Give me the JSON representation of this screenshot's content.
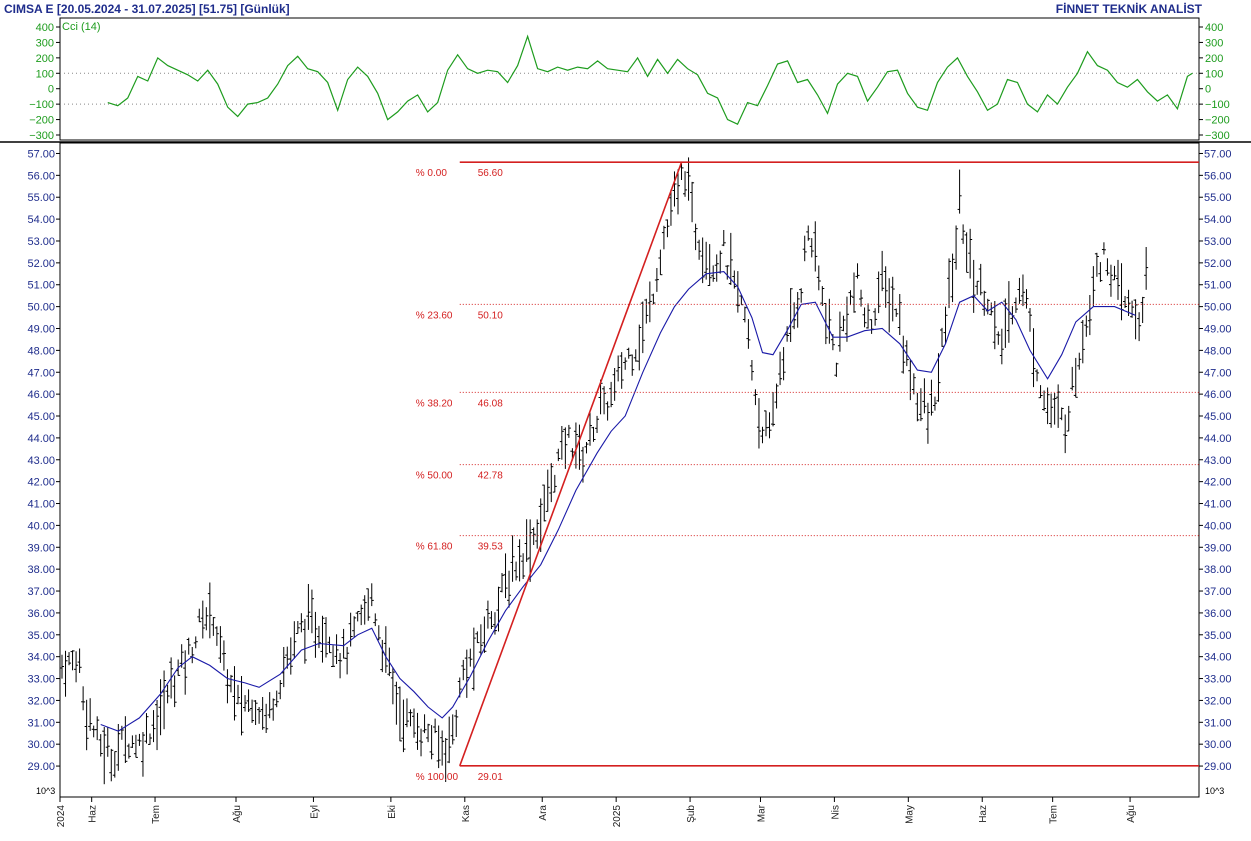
{
  "header": {
    "title": "CIMSA E  [20.05.2024 - 31.07.2025]  [51.75]  [Günlük]",
    "brand": "FİNNET TEKNİK ANALİST"
  },
  "colors": {
    "text": "#1f2d8c",
    "cci": "#1e9c1e",
    "fib": "#d42020",
    "ma": "#1a1aa8",
    "bars": "#000000"
  },
  "chart_data": [
    {
      "type": "line",
      "name": "cci-panel",
      "legend": "Cci (14)",
      "ylim": [
        -300,
        400
      ],
      "ticks": [
        400,
        300,
        200,
        100,
        0,
        -100,
        -200,
        -300
      ],
      "tick_labels": [
        "400",
        "300",
        "200",
        "100",
        "0",
        "−100",
        "−200",
        "−300"
      ],
      "reference_lines": [
        100,
        -100
      ],
      "x": [
        0,
        4,
        8,
        12,
        16,
        20,
        24,
        28,
        32,
        36,
        40,
        44,
        48,
        52,
        56,
        60,
        64,
        68,
        72,
        76,
        80,
        84,
        88,
        92,
        96,
        100,
        104,
        108,
        112,
        116,
        120,
        124,
        128,
        132,
        136,
        140,
        144,
        148,
        152,
        156,
        160,
        164,
        168,
        172,
        176,
        180,
        184,
        188,
        192,
        196,
        200,
        204,
        208,
        212,
        216,
        220,
        224,
        228,
        232,
        236,
        240,
        244,
        248,
        252,
        256,
        260,
        264,
        268,
        272,
        276,
        280,
        284,
        288,
        292,
        296,
        300,
        304,
        308,
        312,
        316,
        320,
        324,
        328,
        332,
        336,
        340,
        344,
        348,
        352,
        356,
        360,
        364,
        368,
        372,
        376,
        380,
        384,
        388,
        392,
        396,
        400,
        404,
        408,
        412,
        416,
        420,
        424,
        428,
        432,
        434
      ],
      "values": [
        -90,
        -110,
        -60,
        80,
        50,
        200,
        150,
        120,
        90,
        50,
        120,
        30,
        -120,
        -180,
        -100,
        -90,
        -60,
        30,
        150,
        210,
        130,
        110,
        40,
        -140,
        60,
        140,
        80,
        -30,
        -200,
        -150,
        -80,
        -40,
        -150,
        -90,
        120,
        220,
        130,
        100,
        120,
        110,
        40,
        150,
        340,
        130,
        110,
        140,
        120,
        140,
        130,
        180,
        130,
        120,
        110,
        200,
        80,
        190,
        100,
        190,
        130,
        90,
        -30,
        -60,
        -200,
        -230,
        -90,
        -110,
        20,
        160,
        180,
        40,
        60,
        -40,
        -160,
        30,
        100,
        80,
        -80,
        10,
        110,
        120,
        -30,
        -120,
        -140,
        40,
        140,
        200,
        80,
        -20,
        -140,
        -100,
        60,
        40,
        -100,
        -150,
        -40,
        -100,
        10,
        100,
        240,
        150,
        120,
        40,
        10,
        60,
        -20,
        -80,
        -40,
        -130,
        80,
        100
      ]
    },
    {
      "type": "bar",
      "name": "price-panel",
      "title": "CIMSA E",
      "unit_label": "10^3",
      "ylim": [
        28.5,
        57.25
      ],
      "ticks": [
        57,
        56,
        55,
        54,
        53,
        52,
        51,
        50,
        49,
        48,
        47,
        46,
        45,
        44,
        43,
        42,
        41,
        40,
        39,
        38,
        37,
        36,
        35,
        34,
        33,
        32,
        31,
        30,
        29
      ],
      "tick_labels": [
        "57.00",
        "56.00",
        "55.00",
        "54.00",
        "53.00",
        "52.00",
        "51.00",
        "50.00",
        "49.00",
        "48.00",
        "47.00",
        "46.00",
        "45.00",
        "44.00",
        "43.00",
        "42.00",
        "41.00",
        "40.00",
        "39.00",
        "38.00",
        "37.00",
        "36.00",
        "35.00",
        "34.00",
        "33.00",
        "32.00",
        "31.00",
        "30.00",
        "29.00"
      ],
      "x_axis": {
        "labels": [
          "2024",
          "Haz",
          "Tem",
          "Ağu",
          "Eyl",
          "Eki",
          "Kas",
          "Ara",
          "2025",
          "Şub",
          "Mar",
          "Nis",
          "May",
          "Haz",
          "Tem",
          "Ağu"
        ],
        "label_positions": [
          0,
          9,
          27,
          50,
          72,
          94,
          115,
          137,
          158,
          179,
          199,
          220,
          241,
          262,
          282,
          304
        ]
      },
      "price_path": [
        [
          0,
          33.6
        ],
        [
          5,
          33.8
        ],
        [
          6,
          32.2
        ],
        [
          10,
          30.2
        ],
        [
          14,
          29.4
        ],
        [
          18,
          30.3
        ],
        [
          22,
          30.0
        ],
        [
          28,
          31.5
        ],
        [
          32,
          33.1
        ],
        [
          36,
          34.1
        ],
        [
          40,
          35.8
        ],
        [
          43,
          36.0
        ],
        [
          46,
          33.5
        ],
        [
          50,
          31.8
        ],
        [
          55,
          32.0
        ],
        [
          58,
          31.2
        ],
        [
          63,
          33.5
        ],
        [
          68,
          35.4
        ],
        [
          72,
          35.4
        ],
        [
          76,
          35.0
        ],
        [
          80,
          34.0
        ],
        [
          84,
          35.3
        ],
        [
          88,
          36.8
        ],
        [
          90,
          35.2
        ],
        [
          96,
          31.5
        ],
        [
          100,
          30.8
        ],
        [
          104,
          30.5
        ],
        [
          108,
          29.8
        ],
        [
          111,
          30.5
        ],
        [
          114,
          33.2
        ],
        [
          118,
          34.3
        ],
        [
          121,
          35.7
        ],
        [
          124,
          36.5
        ],
        [
          128,
          38.0
        ],
        [
          132,
          39.0
        ],
        [
          136,
          40.2
        ],
        [
          140,
          42.5
        ],
        [
          144,
          44.0
        ],
        [
          148,
          43.2
        ],
        [
          152,
          45.0
        ],
        [
          156,
          45.8
        ],
        [
          160,
          47.5
        ],
        [
          164,
          48.5
        ],
        [
          167,
          50.0
        ],
        [
          170,
          52.5
        ],
        [
          174,
          54.8
        ],
        [
          177,
          56.2
        ],
        [
          180,
          53.5
        ],
        [
          185,
          52.0
        ],
        [
          188,
          52.5
        ],
        [
          191,
          51.0
        ],
        [
          194,
          49.5
        ],
        [
          198,
          45.0
        ],
        [
          201,
          43.8
        ],
        [
          204,
          47.2
        ],
        [
          207,
          49.0
        ],
        [
          210,
          51.0
        ],
        [
          212,
          53.5
        ],
        [
          214,
          52.2
        ],
        [
          217,
          49.5
        ],
        [
          220,
          47.5
        ],
        [
          223,
          50.0
        ],
        [
          226,
          51.0
        ],
        [
          229,
          49.0
        ],
        [
          233,
          51.0
        ],
        [
          237,
          50.0
        ],
        [
          240,
          47.5
        ],
        [
          243,
          46.0
        ],
        [
          246,
          44.8
        ],
        [
          249,
          46.5
        ],
        [
          251,
          49.5
        ],
        [
          253,
          51.5
        ],
        [
          255,
          54.5
        ],
        [
          258,
          52.0
        ],
        [
          260,
          51.0
        ],
        [
          263,
          50.5
        ],
        [
          266,
          48.0
        ],
        [
          269,
          49.5
        ],
        [
          272,
          51.0
        ],
        [
          274,
          50.2
        ],
        [
          276,
          48.0
        ],
        [
          279,
          45.8
        ],
        [
          282,
          45.0
        ],
        [
          285,
          44.7
        ],
        [
          288,
          47.0
        ],
        [
          291,
          49.5
        ],
        [
          294,
          52.0
        ],
        [
          297,
          52.2
        ],
        [
          300,
          50.5
        ],
        [
          303,
          50.0
        ],
        [
          306,
          49.3
        ],
        [
          308,
          51.2
        ]
      ],
      "ma_path": [
        [
          11,
          30.9
        ],
        [
          16,
          30.6
        ],
        [
          22,
          31.2
        ],
        [
          28,
          32.3
        ],
        [
          33,
          33.5
        ],
        [
          37,
          34.0
        ],
        [
          42,
          33.6
        ],
        [
          47,
          33.0
        ],
        [
          52,
          32.8
        ],
        [
          56,
          32.6
        ],
        [
          62,
          33.2
        ],
        [
          68,
          34.3
        ],
        [
          73,
          34.6
        ],
        [
          80,
          34.5
        ],
        [
          84,
          35.0
        ],
        [
          88,
          35.3
        ],
        [
          92,
          34.0
        ],
        [
          96,
          33.0
        ],
        [
          100,
          32.4
        ],
        [
          104,
          31.7
        ],
        [
          108,
          31.2
        ],
        [
          111,
          31.7
        ],
        [
          116,
          33.1
        ],
        [
          121,
          34.7
        ],
        [
          126,
          36.1
        ],
        [
          131,
          37.2
        ],
        [
          136,
          38.2
        ],
        [
          141,
          39.8
        ],
        [
          146,
          41.6
        ],
        [
          152,
          43.3
        ],
        [
          156,
          44.3
        ],
        [
          160,
          45.0
        ],
        [
          165,
          47.0
        ],
        [
          170,
          48.8
        ],
        [
          174,
          50.0
        ],
        [
          178,
          50.8
        ],
        [
          183,
          51.5
        ],
        [
          188,
          51.6
        ],
        [
          192,
          50.9
        ],
        [
          196,
          49.5
        ],
        [
          199,
          47.9
        ],
        [
          202,
          47.8
        ],
        [
          206,
          48.9
        ],
        [
          210,
          50.1
        ],
        [
          214,
          50.2
        ],
        [
          219,
          48.6
        ],
        [
          223,
          48.6
        ],
        [
          228,
          48.9
        ],
        [
          233,
          49.0
        ],
        [
          238,
          48.3
        ],
        [
          243,
          47.1
        ],
        [
          247,
          47.0
        ],
        [
          251,
          48.3
        ],
        [
          255,
          50.2
        ],
        [
          259,
          50.5
        ],
        [
          263,
          49.8
        ],
        [
          267,
          50.2
        ],
        [
          271,
          49.4
        ],
        [
          275,
          48.0
        ],
        [
          280,
          46.7
        ],
        [
          284,
          47.8
        ],
        [
          288,
          49.3
        ],
        [
          293,
          50.0
        ],
        [
          299,
          50.0
        ],
        [
          305,
          49.6
        ]
      ],
      "trend_line": [
        [
          113,
          29.01
        ],
        [
          176,
          56.6
        ]
      ],
      "fibonacci": {
        "start_index": 113,
        "levels": [
          {
            "pct": "% 0.00",
            "value": 56.6,
            "label": "56.60",
            "style": "solid"
          },
          {
            "pct": "% 23.60",
            "value": 50.1,
            "label": "50.10",
            "style": "dotted"
          },
          {
            "pct": "% 38.20",
            "value": 46.08,
            "label": "46.08",
            "style": "dotted"
          },
          {
            "pct": "% 50.00",
            "value": 42.78,
            "label": "42.78",
            "style": "dotted"
          },
          {
            "pct": "% 61.80",
            "value": 39.53,
            "label": "39.53",
            "style": "dotted"
          },
          {
            "pct": "% 100.00",
            "value": 29.01,
            "label": "29.01",
            "style": "solid"
          }
        ]
      }
    }
  ]
}
